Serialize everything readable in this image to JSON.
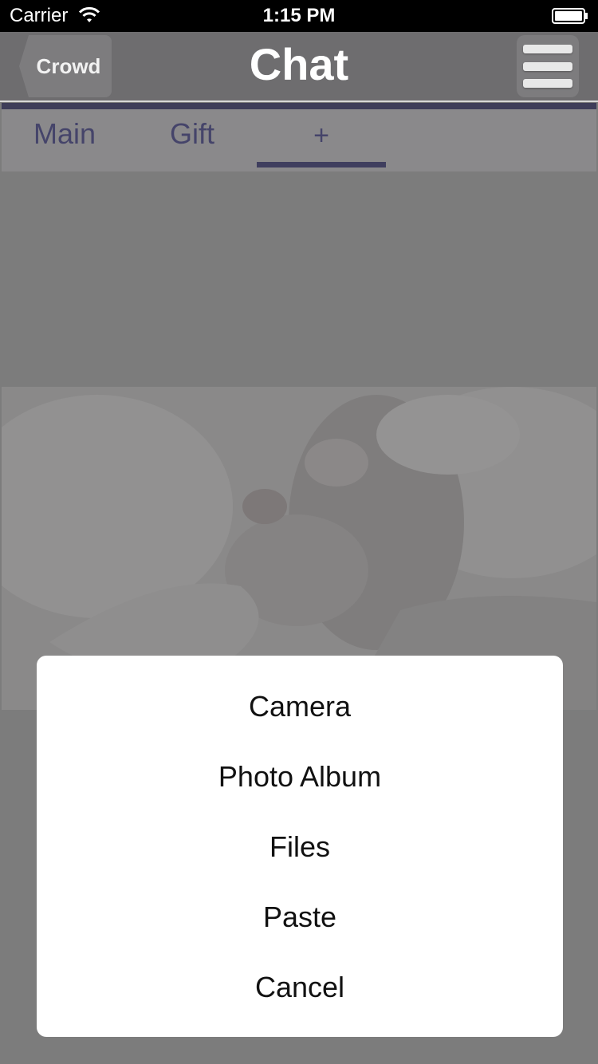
{
  "status_bar": {
    "carrier": "Carrier",
    "time": "1:15 PM",
    "wifi_icon": "wifi-icon",
    "battery_icon": "battery-icon"
  },
  "nav": {
    "back_label": "Crowd",
    "title": "Chat",
    "menu_icon": "hamburger-menu-icon"
  },
  "tabs": [
    {
      "label": "Main",
      "active": false
    },
    {
      "label": "Gift",
      "active": false
    },
    {
      "label": "+",
      "active": true
    }
  ],
  "action_sheet": {
    "items": [
      "Camera",
      "Photo Album",
      "Files",
      "Paste",
      "Cancel"
    ]
  },
  "colors": {
    "status_bar_bg": "#000000",
    "nav_bg": "#6e6d6f",
    "tab_accent": "#3e3d59",
    "tab_text": "#45446a",
    "overlay": "#7c7c7c",
    "sheet_bg": "#ffffff"
  }
}
